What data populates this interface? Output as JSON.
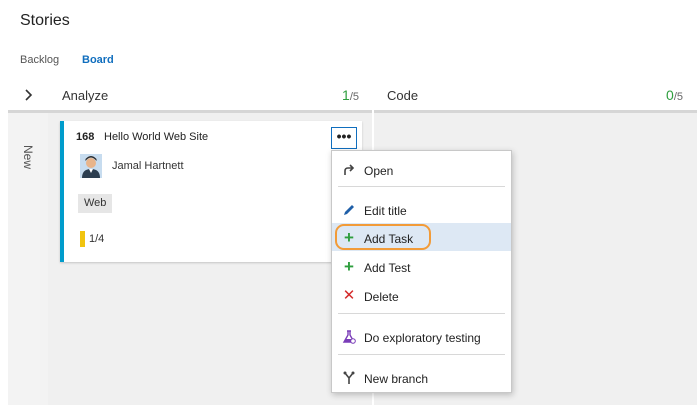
{
  "page": {
    "title": "Stories"
  },
  "tabs": [
    {
      "label": "Backlog",
      "active": false
    },
    {
      "label": "Board",
      "active": true
    }
  ],
  "columns": [
    {
      "name": "Analyze",
      "count": "1",
      "limit": "/5"
    },
    {
      "name": "Code",
      "count": "0",
      "limit": "/5"
    }
  ],
  "swimlane": {
    "label": "New"
  },
  "card": {
    "id": "168",
    "title": "Hello World Web Site",
    "assignee": "Jamal Hartnett",
    "tag": "Web",
    "tasks_progress": "1/4",
    "accent_color": "#009ccc"
  },
  "context_menu": {
    "items": [
      {
        "label": "Open",
        "icon": "open-arrow-icon"
      },
      {
        "label": "Edit title",
        "icon": "pencil-icon"
      },
      {
        "label": "Add Task",
        "icon": "plus-icon",
        "highlighted": true
      },
      {
        "label": "Add Test",
        "icon": "plus-icon"
      },
      {
        "label": "Delete",
        "icon": "x-icon"
      },
      {
        "label": "Do exploratory testing",
        "icon": "flask-icon"
      },
      {
        "label": "New branch",
        "icon": "branch-icon"
      }
    ]
  },
  "colors": {
    "accent": "#106ebe",
    "count_green": "#2e9e3e",
    "highlight_ring": "#f29b38",
    "progress_yellow": "#f1c40f",
    "delete_red": "#d42b2b"
  }
}
